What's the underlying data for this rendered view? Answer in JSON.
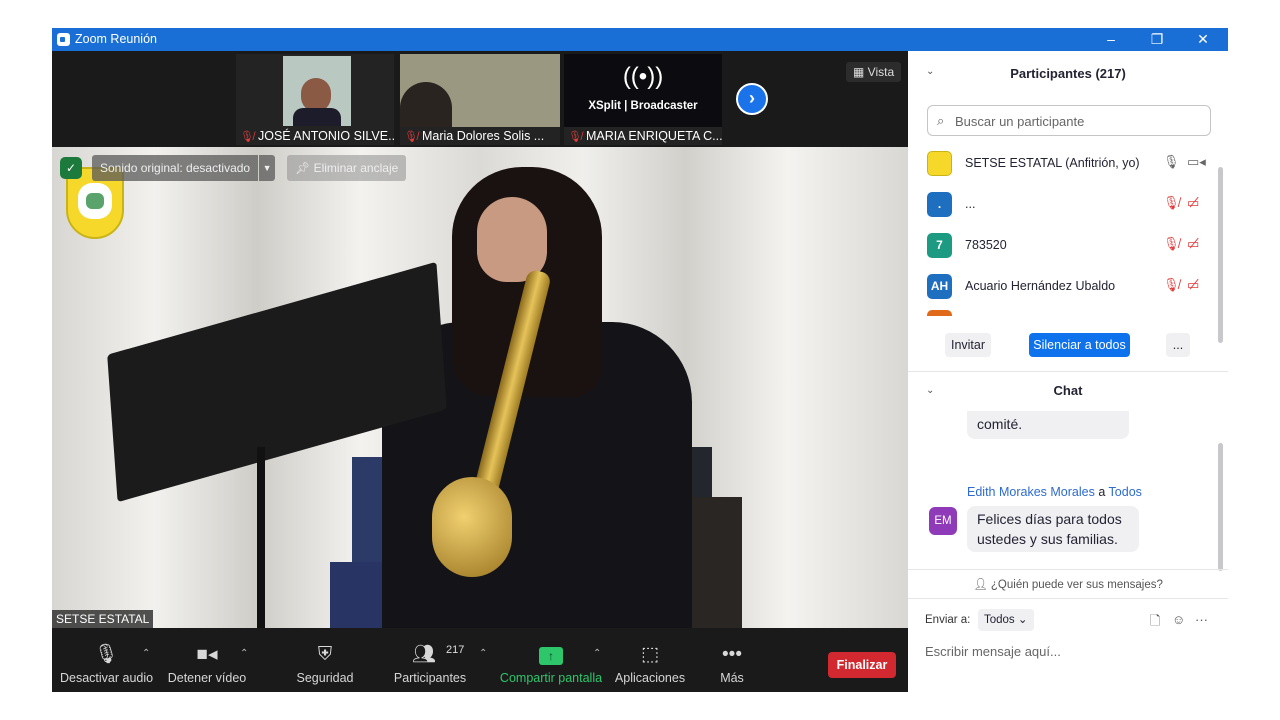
{
  "window": {
    "title": "Zoom Reunión"
  },
  "thumbnails": [
    {
      "name": "JOSÉ ANTONIO SILVE...",
      "muted": true
    },
    {
      "name": "Maria Dolores Solis ...",
      "muted": true
    },
    {
      "name": "MARIA ENRIQUETA C...",
      "muted": true,
      "brand": "XSplit | Broadcaster"
    }
  ],
  "stage": {
    "vista_label": "Vista",
    "sound_label": "Sonido original: desactivado",
    "unpin_label": "Eliminar anclaje",
    "speaker_name": "SETSE ESTATAL"
  },
  "toolbar": {
    "mute_label": "Desactivar audio",
    "video_label": "Detener vídeo",
    "security_label": "Seguridad",
    "participants_label": "Participantes",
    "participants_count": "217",
    "share_label": "Compartir pantalla",
    "apps_label": "Aplicaciones",
    "more_label": "Más",
    "end_label": "Finalizar"
  },
  "participants_panel": {
    "title": "Participantes (217)",
    "search_placeholder": "Buscar un participante",
    "items": [
      {
        "initials": "",
        "name": "SETSE ESTATAL (Anfitrión, yo)",
        "color": "#f5d829"
      },
      {
        "initials": ".",
        "name": "...",
        "color": "#1f6fc0"
      },
      {
        "initials": "7",
        "name": "783520",
        "color": "#1c9b82"
      },
      {
        "initials": "AH",
        "name": "Acuario Hernández Ubaldo",
        "color": "#1f6fc0"
      }
    ],
    "invite_label": "Invitar",
    "mute_all_label": "Silenciar a todos",
    "more_label": "..."
  },
  "chat": {
    "title": "Chat",
    "prev_message_tail": "comité.",
    "sender_first": "Edith Morakes",
    "sender_last": "Morales",
    "to_word": "a",
    "recipient": "Todos",
    "sender_initials": "EM",
    "message": "Felices días para todos ustedes y sus familias.",
    "who_can_see": "¿Quién puede ver sus mensajes?",
    "send_to_label": "Enviar a:",
    "send_to_value": "Todos",
    "input_placeholder": "Escribir mensaje aquí..."
  },
  "colors": {
    "titlebar": "#1a6fd6",
    "end_button": "#d1292f",
    "share_icon": "#2ec66b",
    "muted": "#e23c3c",
    "link": "#2d6bd0"
  }
}
